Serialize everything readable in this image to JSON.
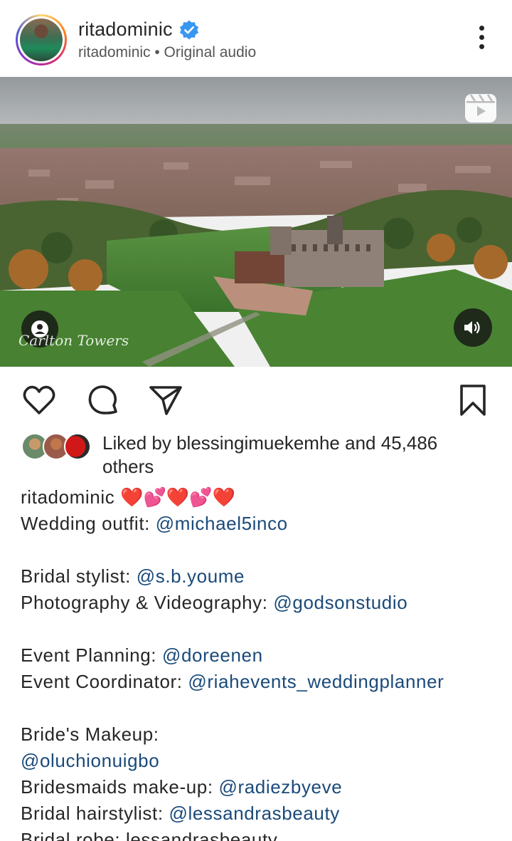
{
  "post": {
    "username": "ritadominic",
    "audio_label": "ritadominic • Original audio",
    "media_watermark": "Carlton Towers"
  },
  "icons": {
    "verified": "verified-badge-icon",
    "more": "more-vertical-icon",
    "reel": "reels-icon",
    "user_tag": "user-tag-icon",
    "sound": "speaker-on-icon",
    "like": "heart-outline-icon",
    "comment": "comment-icon",
    "share": "send-icon",
    "save": "bookmark-outline-icon"
  },
  "likes": {
    "prefix": "Liked by",
    "user": "blessingimuekemhe",
    "connector": "and",
    "count": "45,486",
    "suffix": "others"
  },
  "caption": {
    "owner": "ritadominic",
    "hearts": "❤️💕❤️💕❤️",
    "lines": [
      {
        "label": "Wedding outfit: ",
        "mention": "@michael5inco"
      },
      {
        "label": "",
        "mention": ""
      },
      {
        "label": "Bridal stylist: ",
        "mention": "@s.b.youme"
      },
      {
        "label": "Photography & Videography: ",
        "mention": "@godsonstudio"
      },
      {
        "label": "",
        "mention": ""
      },
      {
        "label": "Event Planning: ",
        "mention": "@doreenen"
      },
      {
        "label": "Event Coordinator: ",
        "mention": "@riahevents_weddingplanner"
      },
      {
        "label": "",
        "mention": ""
      },
      {
        "label": "Bride's Makeup:",
        "mention": ""
      },
      {
        "label": "",
        "mention": "@oluchionuigbo"
      },
      {
        "label": "Bridesmaids make-up: ",
        "mention": "@radiezbyeve"
      },
      {
        "label": "Bridal hairstylist: ",
        "mention": "@lessandrasbeauty"
      },
      {
        "label": "Bridal robe: lessandrasbeauty",
        "mention": ""
      }
    ]
  },
  "colors": {
    "mention": "#1a4a7a",
    "verified": "#3897f0",
    "text": "#262626"
  }
}
